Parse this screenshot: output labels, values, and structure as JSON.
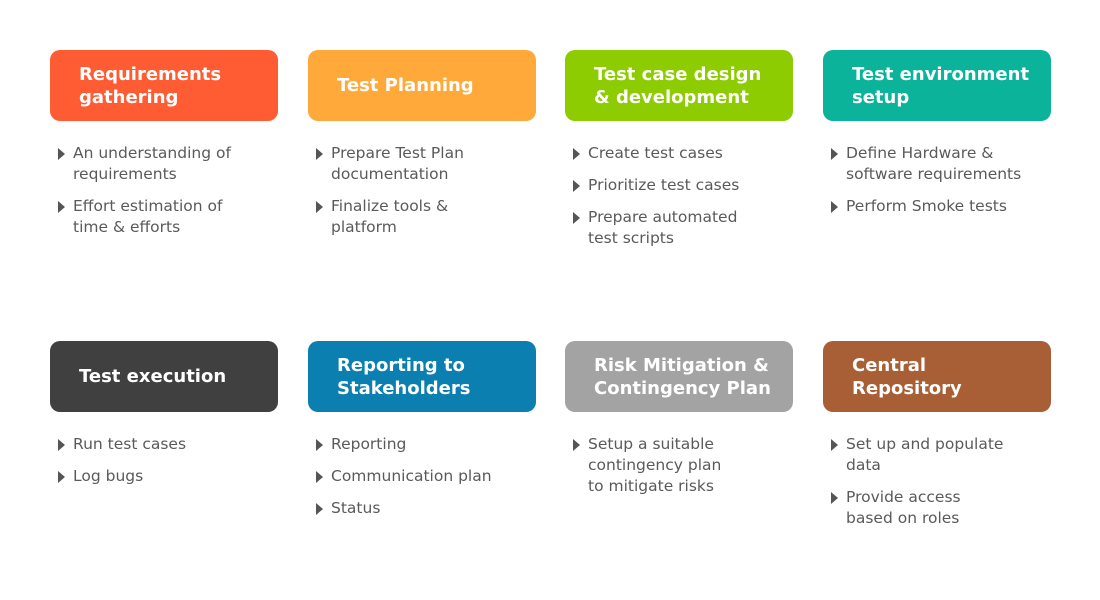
{
  "cards": [
    {
      "title": "Requirements\ngathering",
      "color": "#ff5c33",
      "items": [
        "An understanding of\nrequirements",
        "Effort estimation of\ntime & efforts"
      ]
    },
    {
      "title": "Test Planning",
      "color": "#ffa93a",
      "items": [
        "Prepare Test Plan\ndocumentation",
        "Finalize tools &\nplatform"
      ]
    },
    {
      "title": "Test case design\n& development",
      "color": "#8ccc00",
      "items": [
        "Create test cases",
        "Prioritize test cases",
        "Prepare automated\ntest scripts"
      ]
    },
    {
      "title": "Test environment\nsetup",
      "color": "#0ab39a",
      "items": [
        "Define Hardware &\nsoftware requirements",
        "Perform Smoke tests"
      ]
    },
    {
      "title": "Test execution",
      "color": "#404040",
      "items": [
        "Run test cases",
        "Log bugs"
      ]
    },
    {
      "title": "Reporting to\nStakeholders",
      "color": "#0a7fb0",
      "items": [
        "Reporting",
        "Communication plan",
        "Status"
      ]
    },
    {
      "title": "Risk Mitigation &\nContingency Plan",
      "color": "#a3a3a3",
      "items": [
        "Setup a suitable\ncontingency plan\nto mitigate risks"
      ]
    },
    {
      "title": "Central\nRepository",
      "color": "#a85f35",
      "items": [
        "Set up and populate\ndata",
        "Provide access\nbased on roles"
      ]
    }
  ]
}
